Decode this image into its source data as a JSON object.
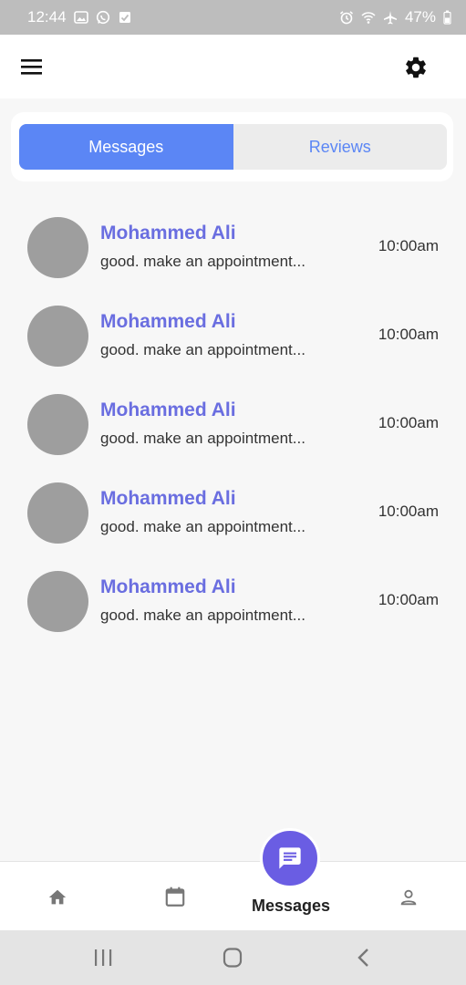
{
  "status_bar": {
    "time": "12:44",
    "battery": "47%",
    "left_icons": [
      "image-icon",
      "whatsapp-icon",
      "check-box-icon"
    ],
    "right_icons": [
      "alarm-icon",
      "wifi-icon",
      "airplane-icon",
      "battery-icon"
    ]
  },
  "header": {
    "menu_icon": "hamburger-menu-icon",
    "settings_icon": "gear-icon"
  },
  "tabs": [
    {
      "label": "Messages",
      "active": true
    },
    {
      "label": "Reviews",
      "active": false
    }
  ],
  "messages": [
    {
      "name": "Mohammed Ali",
      "preview": "good. make an appointment...",
      "time": "10:00am"
    },
    {
      "name": "Mohammed Ali",
      "preview": "good. make an appointment...",
      "time": "10:00am"
    },
    {
      "name": "Mohammed Ali",
      "preview": "good. make an appointment...",
      "time": "10:00am"
    },
    {
      "name": "Mohammed Ali",
      "preview": "good. make an appointment...",
      "time": "10:00am"
    },
    {
      "name": "Mohammed Ali",
      "preview": "good. make an appointment...",
      "time": "10:00am"
    }
  ],
  "bottom_nav": {
    "active_label": "Messages",
    "items": [
      "home-icon",
      "calendar-icon",
      "chat-icon",
      "profile-icon"
    ]
  },
  "colors": {
    "accent_blue": "#5b86f5",
    "name_purple": "#6a6ee0",
    "fab_purple": "#6a5de3",
    "avatar_gray": "#9e9e9e"
  }
}
